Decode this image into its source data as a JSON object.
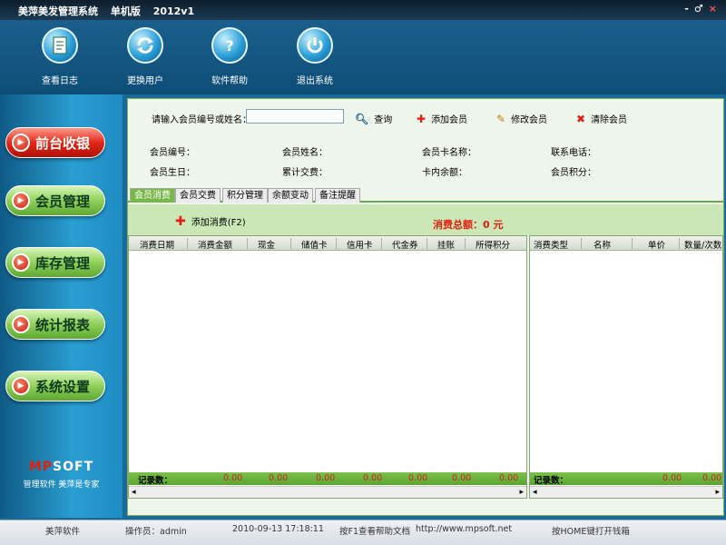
{
  "window": {
    "title": "美萍美发管理系统",
    "edition": "单机版",
    "version": "2012v1",
    "controls": [
      "-",
      "♂",
      "×"
    ]
  },
  "toolbar": [
    {
      "label": "查看日志",
      "icon": "log-icon"
    },
    {
      "label": "更换用户",
      "icon": "switch-user-icon"
    },
    {
      "label": "软件帮助",
      "icon": "help-icon"
    },
    {
      "label": "退出系统",
      "icon": "power-icon"
    }
  ],
  "sidebar": [
    {
      "label": "前台收银",
      "active": true
    },
    {
      "label": "会员管理"
    },
    {
      "label": "库存管理"
    },
    {
      "label": "统计报表"
    },
    {
      "label": "系统设置"
    }
  ],
  "brand": {
    "logo_mp": "MP",
    "logo_rest": "SOFT",
    "tagline": "管理软件  美萍是专家"
  },
  "search": {
    "label": "请输入会员编号或姓名：",
    "value": "",
    "query": "查询",
    "add_member": "添加会员",
    "edit_member": "修改会员",
    "delete_member": "清除会员"
  },
  "member_info": {
    "member_no": "会员编号：",
    "member_name": "会员姓名：",
    "card_name": "会员卡名称：",
    "phone": "联系电话：",
    "birthday": "会员生日：",
    "total_spent": "累计交费：",
    "card_balance": "卡内余额：",
    "points": "会员积分："
  },
  "tabs": [
    "会员消费",
    "会员交费",
    "积分管理",
    "余额变动",
    "备注提醒"
  ],
  "subbar": {
    "add_label": "添加消费(F2)",
    "total_label": "消费总额：0 元"
  },
  "left_grid": {
    "columns": [
      "消费日期",
      "消费金额",
      "现金",
      "储值卡",
      "信用卡",
      "代金券",
      "挂账",
      "所得积分"
    ],
    "footer_label": "记录数：",
    "footer_values": [
      "0.00",
      "0.00",
      "0.00",
      "0.00",
      "0.00",
      "0.00",
      "0.00"
    ]
  },
  "right_grid": {
    "columns": [
      "消费类型",
      "名称",
      "单价",
      "数量/次数"
    ],
    "footer_label": "记录数：",
    "footer_values": [
      "0.00",
      "0.00"
    ]
  },
  "statusbar": {
    "company": "美萍软件",
    "operator": "操作员：admin",
    "datetime": "2010-09-13 17:18:11",
    "help_hint": "按F1查看帮助文档",
    "url": "http://www.mpsoft.net",
    "drawer_hint": "按HOME键打开钱箱"
  }
}
